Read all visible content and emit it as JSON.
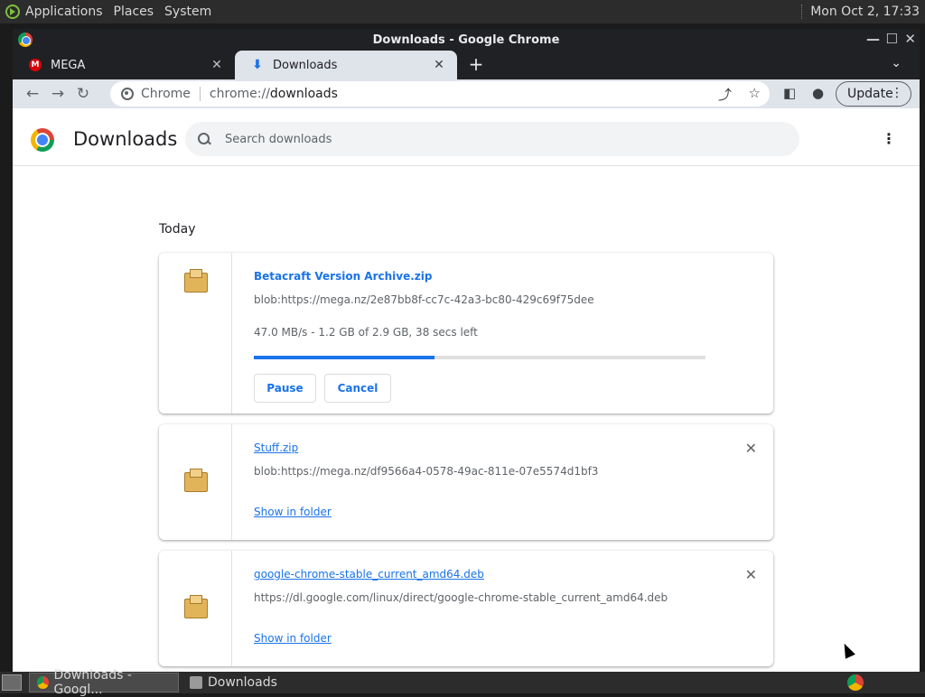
{
  "panel": {
    "menus": [
      "Applications",
      "Places",
      "System"
    ],
    "clock": "Mon Oct  2, 17:33"
  },
  "window": {
    "title": "Downloads - Google Chrome",
    "controls": {
      "minimize": "—",
      "maximize": "☐",
      "close": "✕"
    }
  },
  "tabs": [
    {
      "label": "MEGA",
      "favicon": "M",
      "active": false
    },
    {
      "label": "Downloads",
      "favicon": "⬇",
      "active": true
    }
  ],
  "toolbar": {
    "back": "←",
    "forward": "→",
    "reload": "↻",
    "site_chip": "Chrome",
    "url_scheme": "chrome://",
    "url_host": "downloads",
    "update_label": "Update"
  },
  "page": {
    "title": "Downloads",
    "search_placeholder": "Search downloads",
    "date_heading": "Today"
  },
  "downloads": [
    {
      "name": "Betacraft Version Archive.zip",
      "url": "blob:https://mega.nz/2e87bb8f-cc7c-42a3-bc80-429c69f75dee",
      "status": "47.0 MB/s - 1.2 GB of 2.9 GB, 38 secs left",
      "progress": 0.4,
      "actions": {
        "pause": "Pause",
        "cancel": "Cancel"
      }
    },
    {
      "name": "Stuff.zip",
      "url": "blob:https://mega.nz/df9566a4-0578-49ac-811e-07e5574d1bf3",
      "link": "Show in folder"
    },
    {
      "name": "google-chrome-stable_current_amd64.deb",
      "url": "https://dl.google.com/linux/direct/google-chrome-stable_current_amd64.deb",
      "link": "Show in folder"
    }
  ],
  "taskbar": {
    "tasks": [
      "Downloads - Googl...",
      "Downloads"
    ]
  },
  "colors": {
    "accent": "#1a73e8",
    "frame": "#202124",
    "toolbar": "#dfe3ea"
  }
}
